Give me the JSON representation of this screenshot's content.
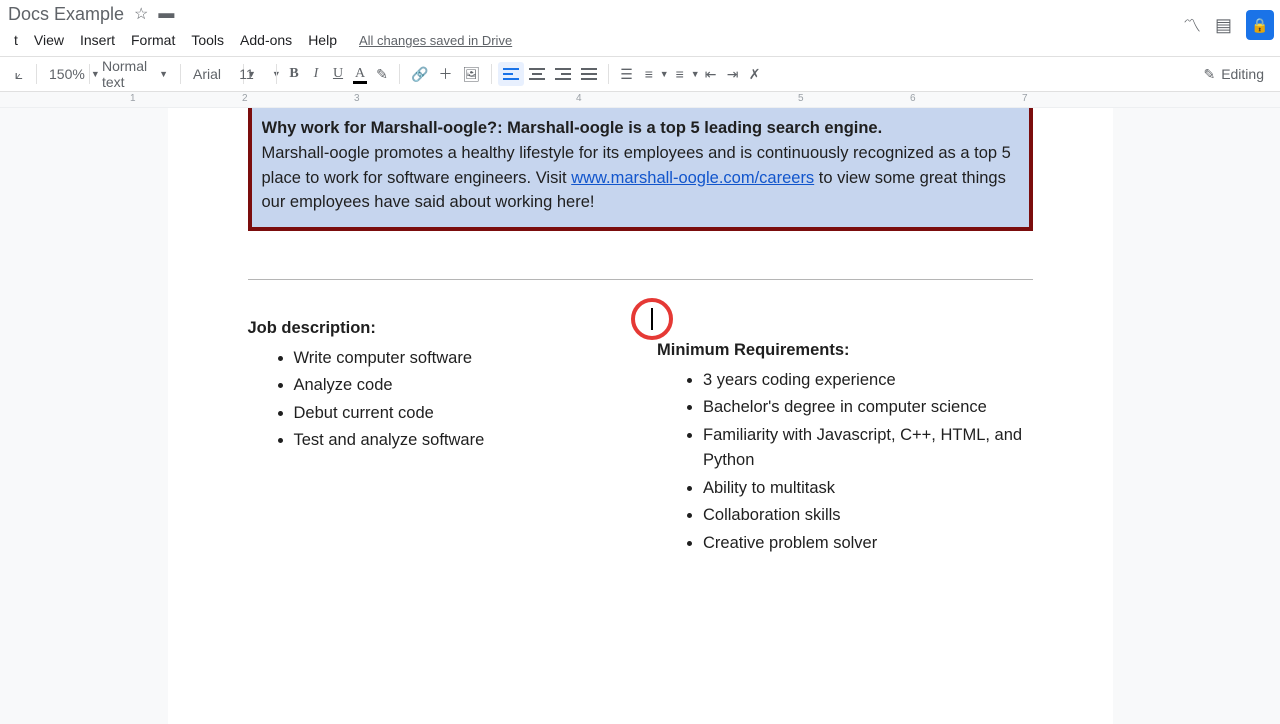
{
  "title": "Docs Example",
  "icons": {
    "star": "☆",
    "folder": "▬",
    "trend": "〽",
    "comment": "▤",
    "lock": "🔒"
  },
  "menus": [
    "t",
    "View",
    "Insert",
    "Format",
    "Tools",
    "Add-ons",
    "Help"
  ],
  "save_status": "All changes saved in Drive",
  "toolbar": {
    "paint": "⟀",
    "zoom": "150%",
    "style": "Normal text",
    "font": "Arial",
    "fontsize": "11",
    "bold": "B",
    "italic": "I",
    "underline": "U",
    "textcolor": "A",
    "highlight": "✎",
    "link": "🔗",
    "addcomment": "＋",
    "image": "🖼",
    "linespace": "☰",
    "numlist": "≡",
    "bulletlist": "≡",
    "outdent": "⇤",
    "indent": "⇥",
    "clearfmt": "✗"
  },
  "editing_label": "Editing",
  "editing_icon": "✎",
  "ruler_marks": [
    "1",
    "2",
    "3",
    "4",
    "5",
    "6",
    "7"
  ],
  "box": {
    "topline": "Why work for Marshall-oogle?: Marshall-oogle is a top 5 leading search engine.",
    "line2a": "Marshall-oogle promotes a healthy lifestyle for its employees and is continuously recognized as a top 5 place to work for software engineers.  Visit ",
    "link_text": "www.marshall-oogle.com/careers",
    "line2b": " to view some great things our employees have said about working here!"
  },
  "job": {
    "heading": "Job description:",
    "items": [
      "Write computer software",
      "Analyze code",
      "Debut current code",
      "Test and analyze software"
    ]
  },
  "reqs": {
    "heading": "Minimum Requirements:",
    "items": [
      "3 years coding experience",
      "Bachelor's degree in computer science",
      "Familiarity with Javascript, C++, HTML, and Python",
      "Ability to multitask",
      "Collaboration skills",
      "Creative problem solver"
    ]
  }
}
